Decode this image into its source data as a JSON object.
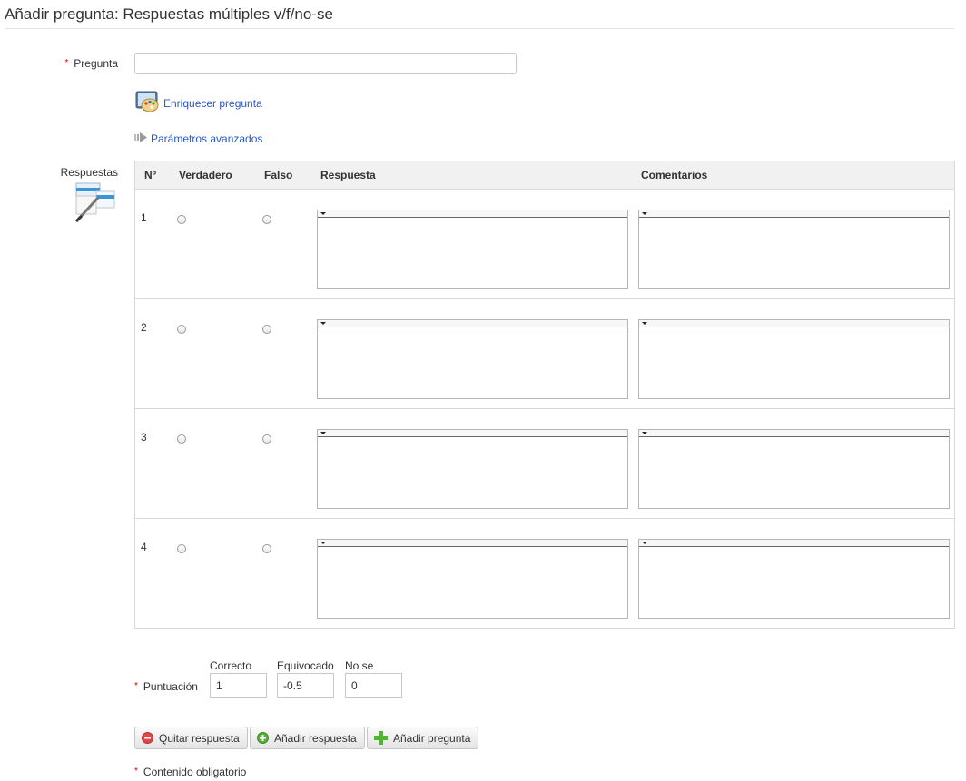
{
  "page": {
    "title": "Añadir pregunta: Respuestas múltiples v/f/no-se"
  },
  "form": {
    "required_mark": "*",
    "question_label": "Pregunta",
    "question_value": "",
    "enrich_link": "Enriquecer pregunta",
    "advanced_link": "Parámetros avanzados",
    "answers_label": "Respuestas"
  },
  "table": {
    "headers": {
      "num": "Nº",
      "true": "Verdadero",
      "false": "Falso",
      "answer": "Respuesta",
      "comment": "Comentarios"
    },
    "rows": [
      {
        "num": "1"
      },
      {
        "num": "2"
      },
      {
        "num": "3"
      },
      {
        "num": "4"
      }
    ]
  },
  "score": {
    "label": "Puntuación",
    "correct_label": "Correcto",
    "wrong_label": "Equivocado",
    "dontknow_label": "No se",
    "correct_value": "1",
    "wrong_value": "-0.5",
    "dontknow_value": "0"
  },
  "buttons": {
    "remove": "Quitar respuesta",
    "add_answer": "Añadir respuesta",
    "add_question": "Añadir pregunta"
  },
  "footer": {
    "required_note": "Contenido obligatorio"
  },
  "colors": {
    "link": "#2a58c6",
    "required": "#dd0000",
    "remove_icon": "#e04848",
    "add_icon": "#5aad3a"
  },
  "icons": [
    "enrich-question-icon",
    "advanced-params-arrow-icon",
    "answers-edit-icon",
    "remove-icon",
    "add-circle-icon",
    "add-plus-icon"
  ]
}
